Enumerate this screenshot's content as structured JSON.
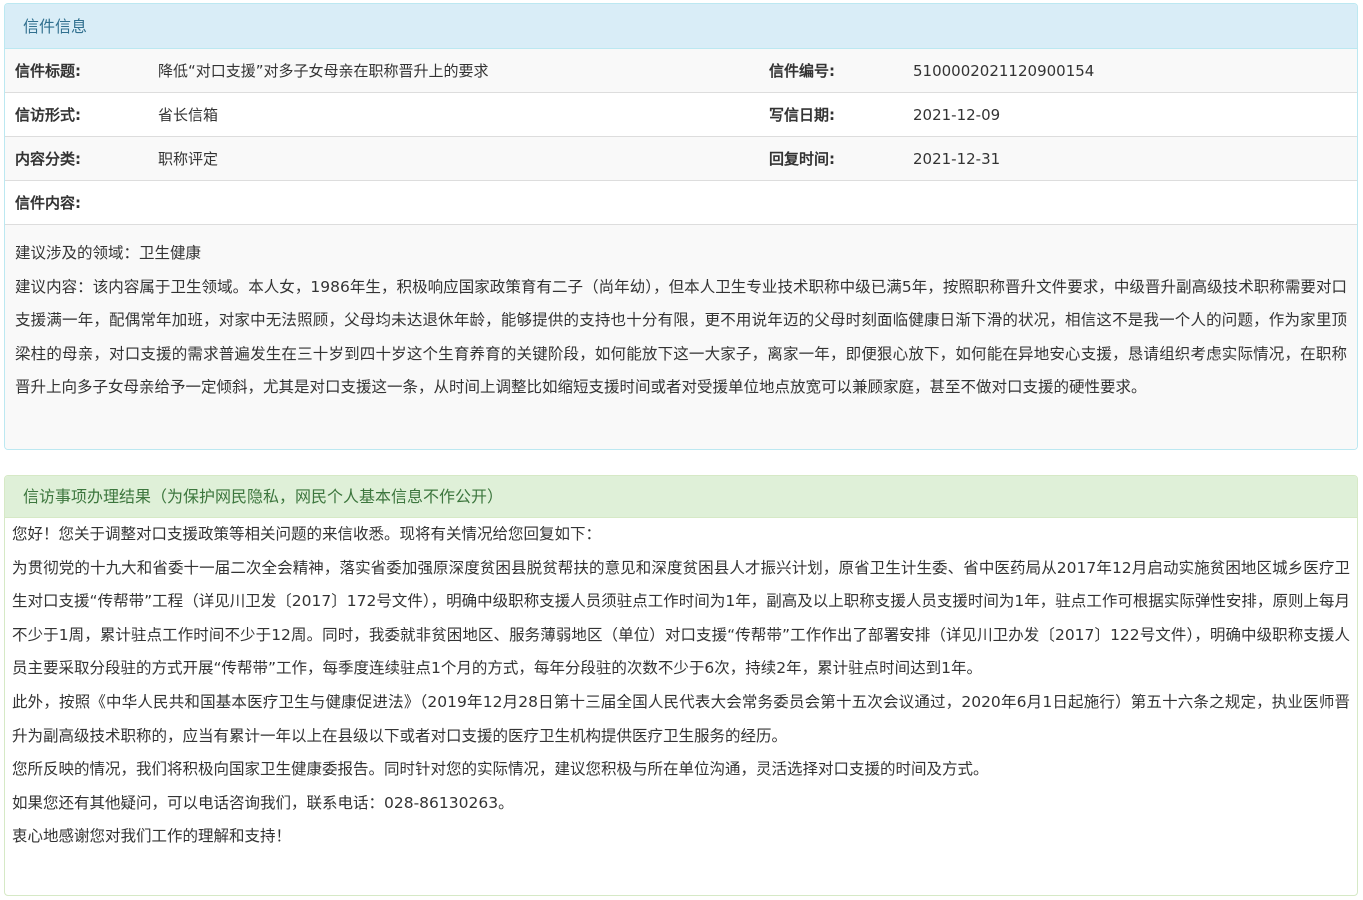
{
  "letter": {
    "heading": "信件信息",
    "rows": [
      {
        "label1": "信件标题:",
        "value1": "降低“对口支援”对多子女母亲在职称晋升上的要求",
        "label2": "信件编号:",
        "value2": "5100002021120900154"
      },
      {
        "label1": "信访形式:",
        "value1": "省长信箱",
        "label2": "写信日期:",
        "value2": "2021-12-09"
      },
      {
        "label1": "内容分类:",
        "value1": "职称评定",
        "label2": "回复时间:",
        "value2": "2021-12-31"
      }
    ],
    "content_label": "信件内容:",
    "content": [
      "建议涉及的领域：卫生健康",
      "建议内容：该内容属于卫生领域。本人女，1986年生，积极响应国家政策育有二子（尚年幼），但本人卫生专业技术职称中级已满5年，按照职称晋升文件要求，中级晋升副高级技术职称需要对口支援满一年，配偶常年加班，对家中无法照顾，父母均未达退休年龄，能够提供的支持也十分有限，更不用说年迈的父母时刻面临健康日渐下滑的状况，相信这不是我一个人的问题，作为家里顶梁柱的母亲，对口支援的需求普遍发生在三十岁到四十岁这个生育养育的关键阶段，如何能放下这一大家子，离家一年，即便狠心放下，如何能在异地安心支援，恳请组织考虑实际情况，在职称晋升上向多子女母亲给予一定倾斜，尤其是对口支援这一条，从时间上调整比如缩短支援时间或者对受援单位地点放宽可以兼顾家庭，甚至不做对口支援的硬性要求。"
    ]
  },
  "result": {
    "heading": "信访事项办理结果（为保护网民隐私，网民个人基本信息不作公开）",
    "paragraphs": [
      "您好！您关于调整对口支援政策等相关问题的来信收悉。现将有关情况给您回复如下：",
      "为贯彻党的十九大和省委十一届二次全会精神，落实省委加强原深度贫困县脱贫帮扶的意见和深度贫困县人才振兴计划，原省卫生计生委、省中医药局从2017年12月启动实施贫困地区城乡医疗卫生对口支援“传帮带”工程（详见川卫发〔2017〕172号文件），明确中级职称支援人员须驻点工作时间为1年，副高及以上职称支援人员支援时间为1年，驻点工作可根据实际弹性安排，原则上每月不少于1周，累计驻点工作时间不少于12周。同时，我委就非贫困地区、服务薄弱地区（单位）对口支援“传帮带”工作作出了部署安排（详见川卫办发〔2017〕122号文件），明确中级职称支援人员主要采取分段驻的方式开展“传帮带”工作，每季度连续驻点1个月的方式，每年分段驻的次数不少于6次，持续2年，累计驻点时间达到1年。",
      "此外，按照《中华人民共和国基本医疗卫生与健康促进法》（2019年12月28日第十三届全国人民代表大会常务委员会第十五次会议通过，2020年6月1日起施行）第五十六条之规定，执业医师晋升为副高级技术职称的，应当有累计一年以上在县级以下或者对口支援的医疗卫生机构提供医疗卫生服务的经历。",
      "您所反映的情况，我们将积极向国家卫生健康委报告。同时针对您的实际情况，建议您积极与所在单位沟通，灵活选择对口支援的时间及方式。",
      "如果您还有其他疑问，可以电话咨询我们，联系电话：028-86130263。",
      "衷心地感谢您对我们工作的理解和支持！"
    ]
  }
}
